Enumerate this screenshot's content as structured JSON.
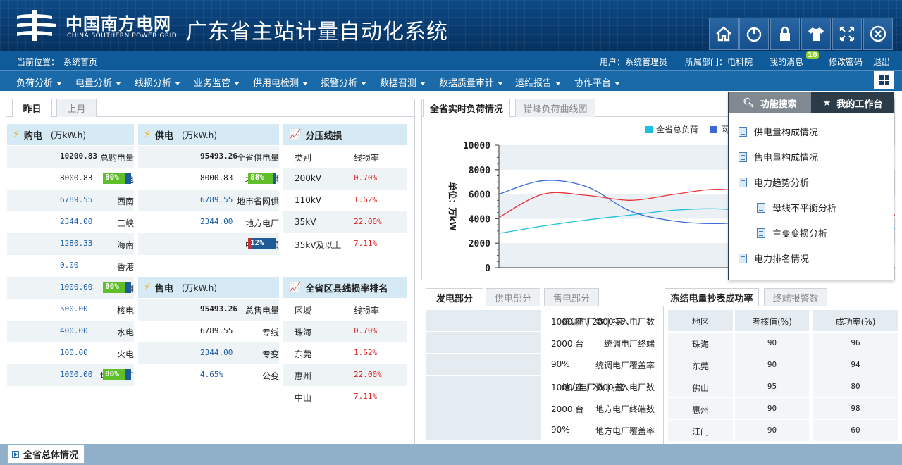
{
  "header": {
    "logo_cn": "中国南方电网",
    "logo_en": "CHINA SOUTHERN POWER GRID",
    "system_title": "广东省主站计量自动化系统",
    "buttons": [
      "home-icon",
      "power-icon",
      "lock-icon",
      "shirt-icon",
      "fullscreen-icon",
      "close-icon"
    ]
  },
  "status": {
    "location_label": "当前位置：",
    "location": "系统首页",
    "user_label": "用户：系统管理员",
    "dept_label": "所属部门：电科院",
    "messages": "我的消息",
    "message_count": "10",
    "change_password": "修改密码",
    "logout": "退出"
  },
  "menu": [
    "负荷分析",
    "电量分析",
    "线损分析",
    "业务监管",
    "供用电检测",
    "报警分析",
    "数据召测",
    "数据质量审计",
    "运维报告",
    "协作平台"
  ],
  "period_tabs": [
    "昨日",
    "上月"
  ],
  "purchase": {
    "title": "购电",
    "unit": "(万kW.h)",
    "rows": [
      {
        "label": "总购电量",
        "value": "10200.83"
      },
      {
        "label": "外购电",
        "value": "8000.83",
        "pct": "80%",
        "pct_value": 0.8
      },
      {
        "label": "西南",
        "value": "6789.55"
      },
      {
        "label": "三峡",
        "value": "2344.00"
      },
      {
        "label": "海南",
        "value": "1280.33"
      },
      {
        "label": "香港",
        "value": "0.00"
      },
      {
        "label": "统调",
        "value": "1000.00",
        "pct": "80%",
        "pct_value": 0.8
      },
      {
        "label": "核电",
        "value": "500.00"
      },
      {
        "label": "水电",
        "value": "400.00"
      },
      {
        "label": "火电",
        "value": "100.00"
      },
      {
        "label": "地方电厂",
        "value": "1000.00",
        "pct": "80%",
        "pct_value": 0.8
      }
    ]
  },
  "supply": {
    "title": "供电",
    "unit": "(万kW.h)",
    "rows": [
      {
        "label": "全省供电量",
        "value": "95493.26"
      },
      {
        "label": "地市总供",
        "value": "8000.83",
        "pct": "88%",
        "pct_value": 0.88
      },
      {
        "label": "地市省网供",
        "value": "6789.55"
      },
      {
        "label": "地方电厂",
        "value": "2344.00"
      },
      {
        "label": "中调网损",
        "value": "",
        "pct": "12%",
        "pct_value": 0.12
      }
    ]
  },
  "sales": {
    "title": "售电",
    "unit": "(万kW.h)",
    "rows": [
      {
        "label": "总售电量",
        "value": "95493.26"
      },
      {
        "label": "专线",
        "value": "6789.55"
      },
      {
        "label": "专变",
        "value": "2344.00"
      },
      {
        "label": "公变",
        "value": "4.65%"
      }
    ]
  },
  "voltage_loss": {
    "title": "分压线损",
    "headers": [
      "类别",
      "线损率"
    ],
    "rows": [
      [
        "200kV",
        "0.70%"
      ],
      [
        "110kV",
        "1.62%"
      ],
      [
        "35kV",
        "22.00%"
      ],
      [
        "35kV及以上",
        "7.11%"
      ]
    ]
  },
  "county_loss": {
    "title": "全省区县线损率排名",
    "headers": [
      "区域",
      "线损率"
    ],
    "rows": [
      [
        "珠海",
        "0.70%"
      ],
      [
        "东莞",
        "1.62%"
      ],
      [
        "惠州",
        "22.00%"
      ],
      [
        "中山",
        "7.11%"
      ]
    ]
  },
  "chart_tabs": [
    "全省实时负荷情况",
    "错峰负荷曲线图"
  ],
  "chart_data": {
    "type": "line",
    "ylabel": "单位：万kW",
    "ylim": [
      0,
      10000
    ],
    "yticks": [
      "10000",
      "8000",
      "6000",
      "4000",
      "2000",
      "0"
    ],
    "series": [
      {
        "name": "全省总负荷",
        "color": "#1fbfe0",
        "values": [
          2800,
          3400,
          3900,
          4300,
          4700,
          4800,
          4500,
          4300,
          3700,
          3200
        ]
      },
      {
        "name": "网",
        "color": "#3a6ad8",
        "values": [
          6000,
          7100,
          6600,
          4600,
          3800,
          3600,
          3900,
          4500,
          5300,
          6000
        ]
      },
      {
        "name": "",
        "color": "#e8343a",
        "values": [
          4100,
          6000,
          5900,
          5500,
          6000,
          6400,
          5900,
          5000,
          4600,
          4300
        ]
      }
    ]
  },
  "dropdown": {
    "search_tab": "功能搜索",
    "workspace_tab": "我的工作台",
    "items": [
      {
        "label": "供电量构成情况",
        "level": 0
      },
      {
        "label": "售电量构成情况",
        "level": 0
      },
      {
        "label": "电力趋势分析",
        "level": 0
      },
      {
        "label": "母线不平衡分析",
        "level": 1
      },
      {
        "label": "主变变损分析",
        "level": 1
      },
      {
        "label": "电力排名情况",
        "level": 0
      }
    ]
  },
  "gen_tabs": [
    "发电部分",
    "供电部分",
    "售电部分"
  ],
  "generation": [
    {
      "label": "统调电厂数 | 接入电厂数",
      "value": "1000 座 | 2000 座"
    },
    {
      "label": "统调电厂终端",
      "value": "2000 台"
    },
    {
      "label": "统调电厂覆盖率",
      "value": "90%"
    },
    {
      "label": "地方电厂数 | 接入电厂数",
      "value": "1000 座 | 2000 座"
    },
    {
      "label": "地方电厂终端数",
      "value": "2000 台"
    },
    {
      "label": "地方电厂覆盖率",
      "value": "90%"
    }
  ],
  "meter_tabs": [
    "冻结电量抄表成功率",
    "终端报警数"
  ],
  "meter": {
    "headers": [
      "地区",
      "考核值(%)",
      "成功率(%)"
    ],
    "rows": [
      [
        "珠海",
        "90",
        "96"
      ],
      [
        "东莞",
        "90",
        "94"
      ],
      [
        "佛山",
        "95",
        "80"
      ],
      [
        "惠州",
        "90",
        "98"
      ],
      [
        "江门",
        "90",
        "60"
      ]
    ]
  },
  "footer": {
    "label": "全省总体情况"
  }
}
